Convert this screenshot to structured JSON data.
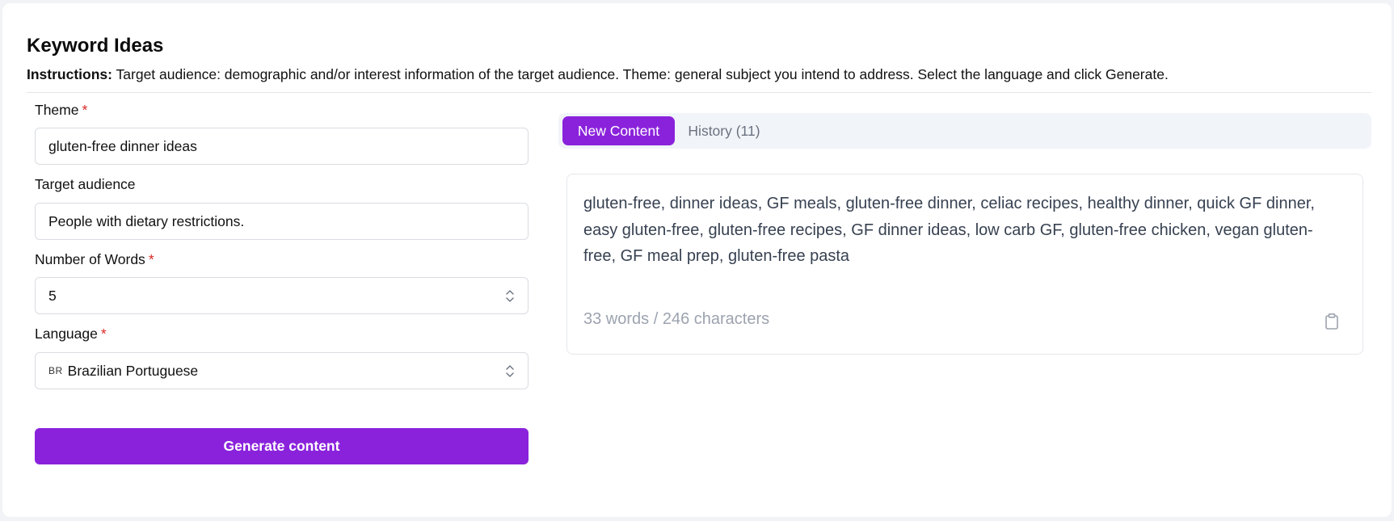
{
  "header": {
    "title": "Keyword Ideas",
    "instructions_label": "Instructions:",
    "instructions_text": "Target audience: demographic and/or interest information of the target audience. Theme: general subject you intend to address. Select the language and click Generate."
  },
  "form": {
    "theme": {
      "label": "Theme",
      "required_mark": "*",
      "value": "gluten-free dinner ideas"
    },
    "target_audience": {
      "label": "Target audience",
      "value": "People with dietary restrictions."
    },
    "number_of_words": {
      "label": "Number of Words",
      "required_mark": "*",
      "value": "5"
    },
    "language": {
      "label": "Language",
      "required_mark": "*",
      "flag": "BR",
      "value": "Brazilian Portuguese"
    },
    "generate_label": "Generate content"
  },
  "tabs": [
    {
      "label": "New Content",
      "active": true
    },
    {
      "label": "History (11)",
      "active": false
    }
  ],
  "output": {
    "text": "gluten-free, dinner ideas, GF meals, gluten-free dinner, celiac recipes, healthy dinner, quick GF dinner, easy gluten-free, gluten-free recipes, GF dinner ideas, low carb GF, gluten-free chicken, vegan gluten-free, GF meal prep, gluten-free pasta",
    "counts": "33 words / 246 characters",
    "copy_icon": "clipboard-icon"
  },
  "colors": {
    "accent": "#8a22dc",
    "required": "#dc2626",
    "muted_text": "#9ca3af"
  }
}
